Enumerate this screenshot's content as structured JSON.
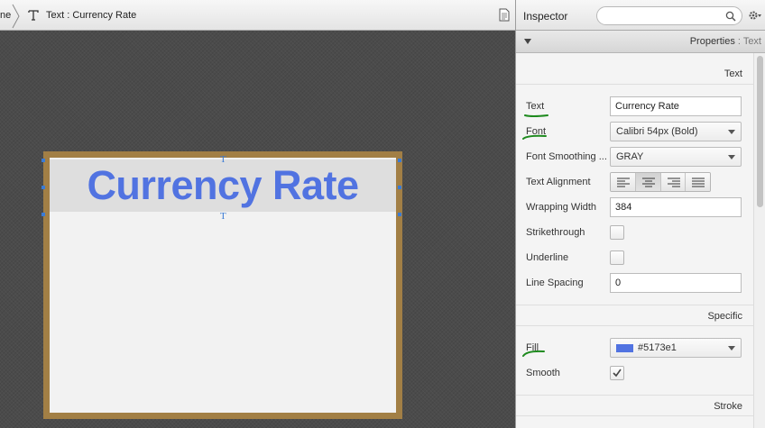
{
  "breadcrumb": {
    "previous_fragment": "ne",
    "current": "Text : Currency Rate"
  },
  "canvas": {
    "text_value": "Currency Rate",
    "text_color": "#5173e1",
    "artboard_border_color": "#a27f45"
  },
  "inspector": {
    "title": "Inspector",
    "search_placeholder": "",
    "properties_label": "Properties",
    "properties_sub": " : Text",
    "sections": {
      "text": "Text",
      "specific": "Specific",
      "stroke": "Stroke"
    },
    "fields": {
      "text_label": "Text",
      "text_value": "Currency Rate",
      "font_label": "Font",
      "font_value": "Calibri 54px (Bold)",
      "smoothing_label": "Font Smoothing ...",
      "smoothing_value": "GRAY",
      "alignment_label": "Text Alignment",
      "alignment_selected": "center",
      "wrapping_label": "Wrapping Width",
      "wrapping_value": "384",
      "strikethrough_label": "Strikethrough",
      "strikethrough_checked": false,
      "underline_label": "Underline",
      "underline_checked": false,
      "line_spacing_label": "Line Spacing",
      "line_spacing_value": "0",
      "fill_label": "Fill",
      "fill_value": "#5173e1",
      "fill_color": "#5173e1",
      "smooth_label": "Smooth",
      "smooth_checked": true
    }
  },
  "colors": {
    "annotation_green": "#1e8a1e",
    "selection_blue": "#3a7bd5"
  }
}
